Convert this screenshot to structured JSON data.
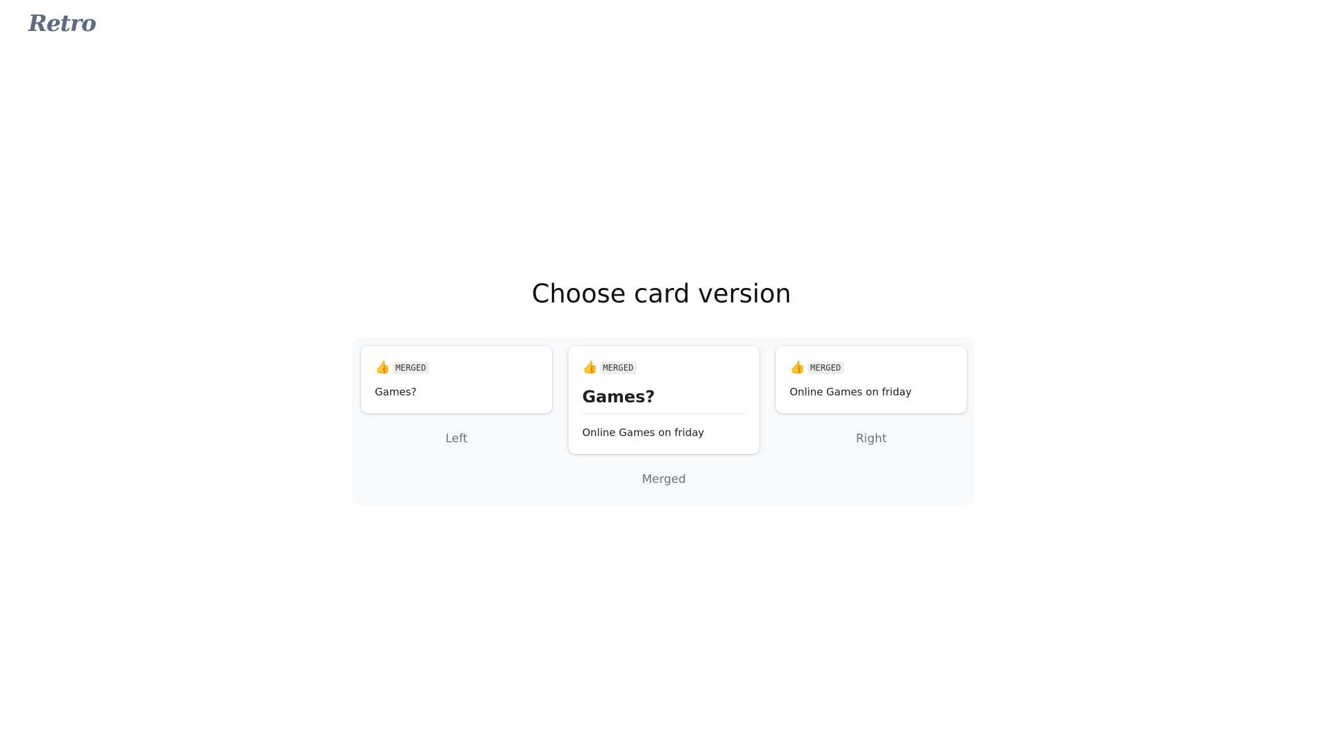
{
  "app": {
    "logo": "Retro"
  },
  "page": {
    "title": "Choose card version"
  },
  "options": {
    "left": {
      "badge": "MERGED",
      "text": "Games?",
      "caption": "Left"
    },
    "merged": {
      "badge": "MERGED",
      "title": "Games?",
      "text": "Online Games on friday",
      "caption": "Merged"
    },
    "right": {
      "badge": "MERGED",
      "text": "Online Games on friday",
      "caption": "Right"
    }
  },
  "icons": {
    "reaction": "thumbs-up-icon"
  },
  "colors": {
    "logo": "#5b6b82",
    "panel_bg": "#f8f9fa",
    "thumb": "#f5b400",
    "caption": "#6b7280"
  }
}
